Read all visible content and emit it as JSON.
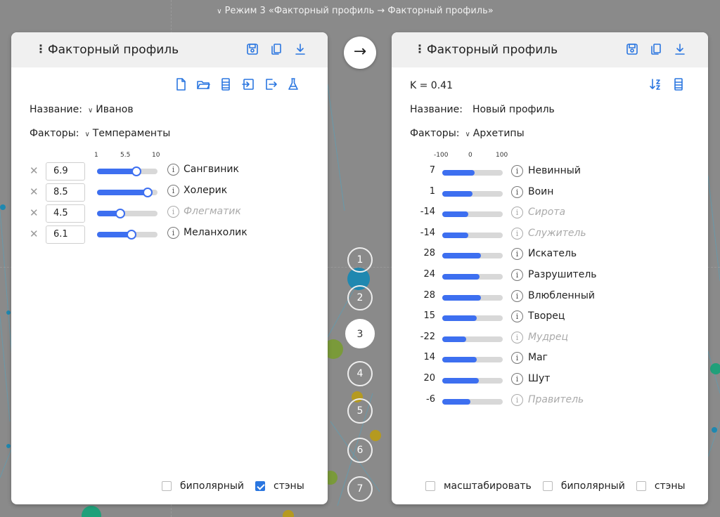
{
  "mode_title": "Режим 3 «Факторный профиль → Факторный профиль»",
  "colors": {
    "accent": "#3d6ff0",
    "icon_blue": "#2a76e0",
    "background": "#8a8a8a"
  },
  "left": {
    "title": "Факторный профиль",
    "header_icons": [
      "save-icon",
      "copy-icon",
      "download-icon"
    ],
    "toolbar_icons": [
      "new-file-icon",
      "open-folder-icon",
      "list-icon",
      "import-icon",
      "export-icon",
      "flask-icon"
    ],
    "name_label": "Название:",
    "name_value": "Иванов",
    "factors_label": "Факторы:",
    "factors_value": "Темпераменты",
    "scale": {
      "min": "1",
      "mid": "5.5",
      "max": "10"
    },
    "factors": [
      {
        "value": "6.9",
        "level": 6.9,
        "name": "Сангвиник",
        "muted": false
      },
      {
        "value": "8.5",
        "level": 8.5,
        "name": "Холерик",
        "muted": false
      },
      {
        "value": "4.5",
        "level": 4.5,
        "name": "Флегматик",
        "muted": true
      },
      {
        "value": "6.1",
        "level": 6.1,
        "name": "Меланхолик",
        "muted": false
      }
    ],
    "checkboxes": [
      {
        "label": "биполярный",
        "checked": false
      },
      {
        "label": "стэны",
        "checked": true
      }
    ]
  },
  "right": {
    "title": "Факторный профиль",
    "header_icons": [
      "save-icon",
      "copy-icon",
      "download-icon"
    ],
    "toolbar_icons": [
      "sort-icon",
      "list-icon"
    ],
    "k_label": "K = 0.41",
    "name_label": "Название:",
    "name_value": "Новый профиль",
    "factors_label": "Факторы:",
    "factors_value": "Архетипы",
    "scale": {
      "min": "-100",
      "mid": "0",
      "max": "100"
    },
    "factors": [
      {
        "value": "7",
        "level": 7,
        "name": "Невинный",
        "muted": false
      },
      {
        "value": "1",
        "level": 1,
        "name": "Воин",
        "muted": false
      },
      {
        "value": "-14",
        "level": -14,
        "name": "Сирота",
        "muted": true
      },
      {
        "value": "-14",
        "level": -14,
        "name": "Служитель",
        "muted": true
      },
      {
        "value": "28",
        "level": 28,
        "name": "Искатель",
        "muted": false
      },
      {
        "value": "24",
        "level": 24,
        "name": "Разрушитель",
        "muted": false
      },
      {
        "value": "28",
        "level": 28,
        "name": "Влюбленный",
        "muted": false
      },
      {
        "value": "15",
        "level": 15,
        "name": "Творец",
        "muted": false
      },
      {
        "value": "-22",
        "level": -22,
        "name": "Мудрец",
        "muted": true
      },
      {
        "value": "14",
        "level": 14,
        "name": "Маг",
        "muted": false
      },
      {
        "value": "20",
        "level": 20,
        "name": "Шут",
        "muted": false
      },
      {
        "value": "-6",
        "level": -6,
        "name": "Правитель",
        "muted": true
      }
    ],
    "checkboxes": [
      {
        "label": "масштабировать",
        "checked": false
      },
      {
        "label": "биполярный",
        "checked": false
      },
      {
        "label": "стэны",
        "checked": false
      }
    ]
  },
  "steps": [
    "1",
    "2",
    "3",
    "4",
    "5",
    "6",
    "7"
  ],
  "active_step": "3"
}
